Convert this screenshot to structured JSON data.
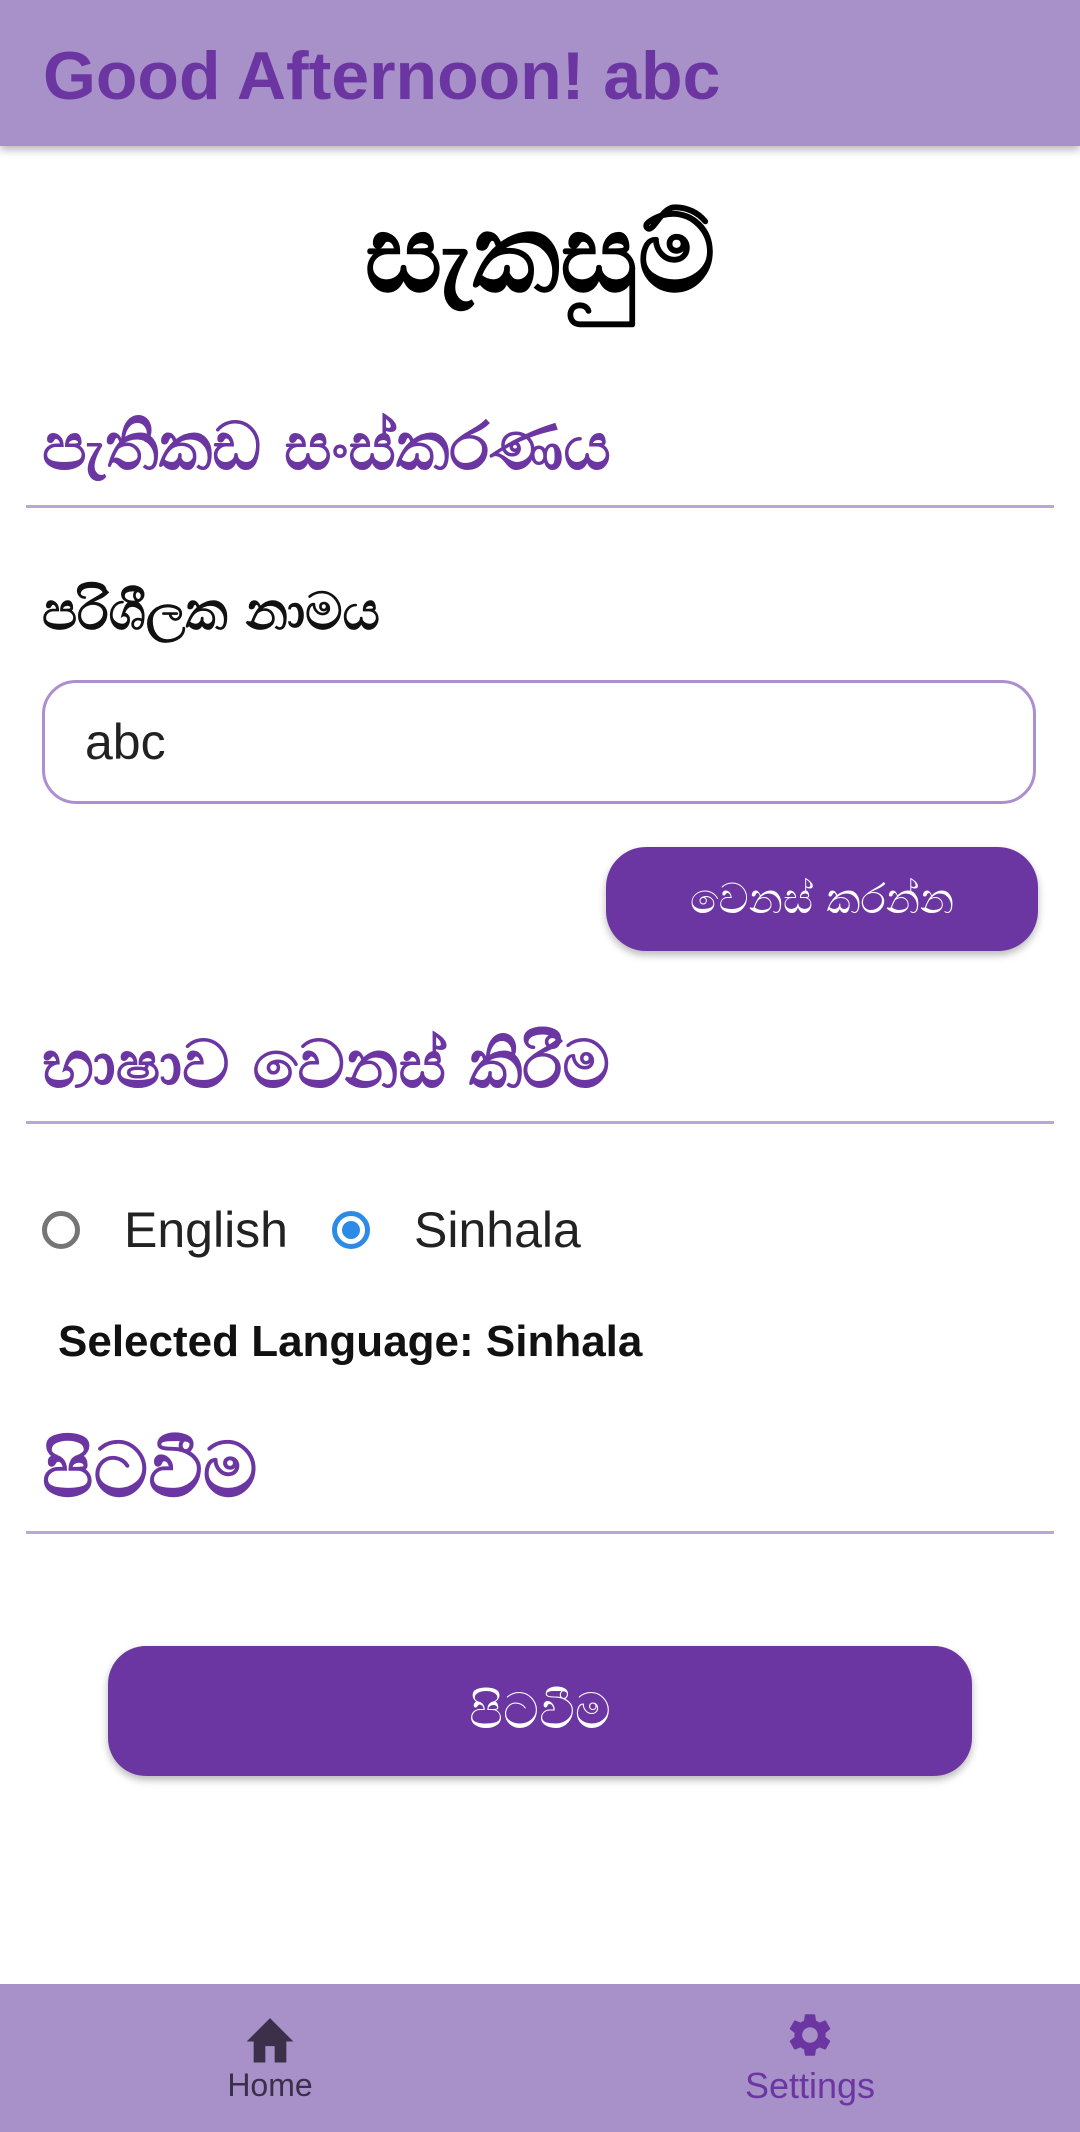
{
  "app_bar": {
    "title": "Good Afternoon! abc"
  },
  "page": {
    "title": "සැකසුම්"
  },
  "profile_section": {
    "heading": "පැතිකඩ සංස්කරණය",
    "username_label": "පරිශීලක නාමය",
    "username_value": "abc",
    "change_button": "වෙනස් කරන්න"
  },
  "language_section": {
    "heading": "භාෂාව වෙනස් කිරීම",
    "options": [
      {
        "label": "English",
        "selected": false
      },
      {
        "label": "Sinhala",
        "selected": true
      }
    ],
    "selected_text": "Selected Language: Sinhala"
  },
  "logout_section": {
    "heading": "පිටවීම",
    "button": "පිටවීම"
  },
  "bottom_nav": {
    "items": [
      {
        "label": "Home",
        "icon": "home-icon",
        "active": false
      },
      {
        "label": "Settings",
        "icon": "gear-icon",
        "active": true
      }
    ]
  },
  "colors": {
    "app_bar": "#a891c9",
    "primary": "#6c36a2",
    "radio_selected": "#2b8be6",
    "divider": "#b9a7d6"
  }
}
